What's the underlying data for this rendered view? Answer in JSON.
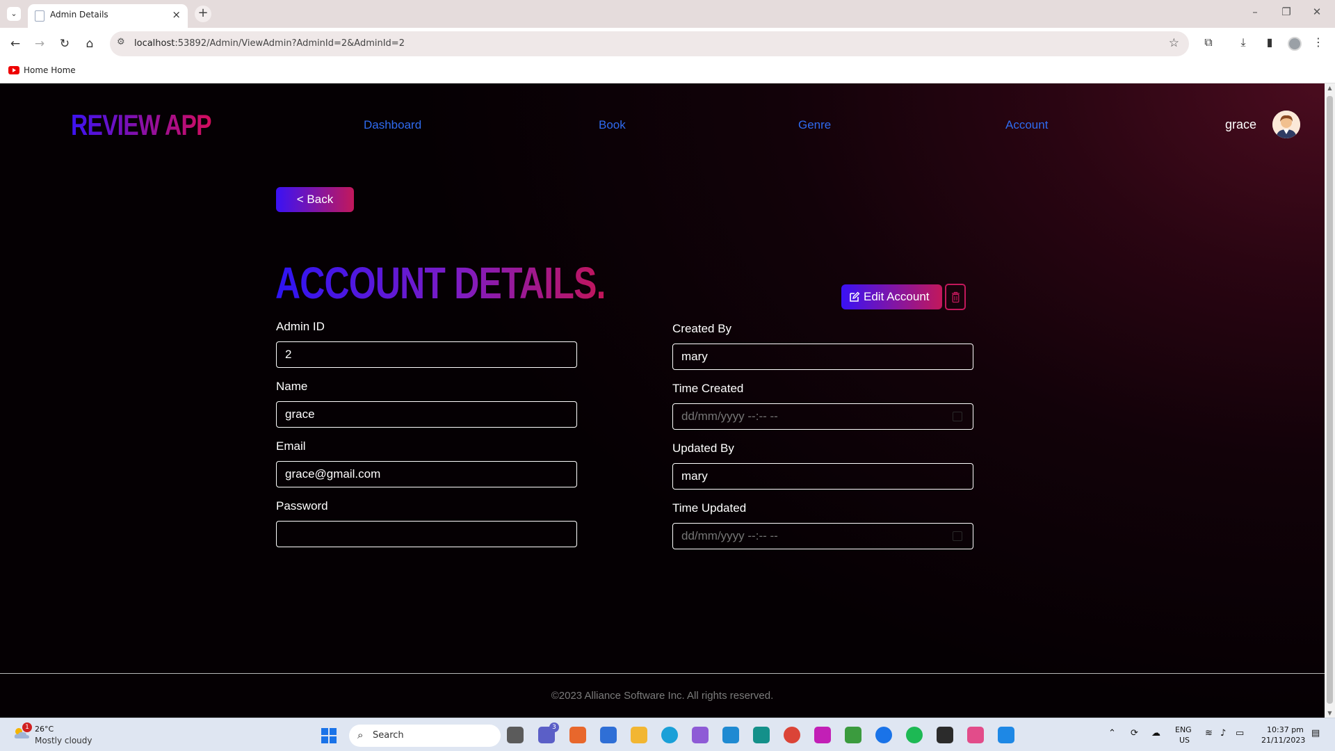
{
  "browser": {
    "tab_title": "Admin Details",
    "url_host": "localhost",
    "url_rest": ":53892/Admin/ViewAdmin?AdminId=2&AdminId=2",
    "bookmark_label": "Home Home"
  },
  "header": {
    "logo": "REVIEW APP",
    "nav": [
      "Dashboard",
      "Book",
      "Genre",
      "Account"
    ],
    "user_name": "grace"
  },
  "main": {
    "back_label": "< Back",
    "title": "ACCOUNT DETAILS.",
    "edit_label": "Edit Account",
    "left_fields": [
      {
        "label": "Admin ID",
        "value": "2",
        "placeholder": ""
      },
      {
        "label": "Name",
        "value": "grace",
        "placeholder": ""
      },
      {
        "label": "Email",
        "value": "grace@gmail.com",
        "placeholder": ""
      },
      {
        "label": "Password",
        "value": "",
        "placeholder": ""
      }
    ],
    "right_fields": [
      {
        "label": "Created By",
        "value": "mary",
        "placeholder": ""
      },
      {
        "label": "Time Created",
        "value": "",
        "placeholder": "dd/mm/yyyy --:-- --"
      },
      {
        "label": "Updated By",
        "value": "mary",
        "placeholder": ""
      },
      {
        "label": "Time Updated",
        "value": "",
        "placeholder": "dd/mm/yyyy --:-- --"
      }
    ]
  },
  "footer": {
    "text": "©2023 Alliance Software Inc. All rights reserved."
  },
  "taskbar": {
    "weather_badge": "1",
    "weather_temp": "26°C",
    "weather_desc": "Mostly cloudy",
    "search_label": "Search",
    "teams_badge": "3",
    "lang_top": "ENG",
    "lang_bottom": "US",
    "time": "10:37 pm",
    "date": "21/11/2023"
  },
  "colors": {
    "accent_blue": "#3a12f5",
    "accent_pink": "#c2185b",
    "nav_link": "#2f6bf0"
  }
}
